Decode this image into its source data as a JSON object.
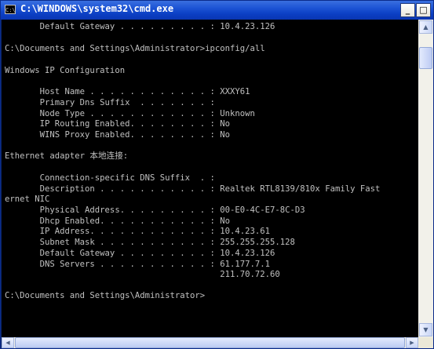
{
  "window": {
    "title": "C:\\WINDOWS\\system32\\cmd.exe",
    "icon_text": "C:\\",
    "minimize_glyph": "_",
    "maximize_glyph": "□",
    "close_glyph": "×"
  },
  "console": {
    "lines": [
      "       Default Gateway . . . . . . . . . : 10.4.23.126",
      "",
      "C:\\Documents and Settings\\Administrator>ipconfig/all",
      "",
      "Windows IP Configuration",
      "",
      "       Host Name . . . . . . . . . . . . : XXXY61",
      "       Primary Dns Suffix  . . . . . . . :",
      "       Node Type . . . . . . . . . . . . : Unknown",
      "       IP Routing Enabled. . . . . . . . : No",
      "       WINS Proxy Enabled. . . . . . . . : No",
      "",
      "Ethernet adapter 本地连接:",
      "",
      "       Connection-specific DNS Suffix  . :",
      "       Description . . . . . . . . . . . : Realtek RTL8139/810x Family Fast",
      "ernet NIC",
      "       Physical Address. . . . . . . . . : 00-E0-4C-E7-8C-D3",
      "       Dhcp Enabled. . . . . . . . . . . : No",
      "       IP Address. . . . . . . . . . . . : 10.4.23.61",
      "       Subnet Mask . . . . . . . . . . . : 255.255.255.128",
      "       Default Gateway . . . . . . . . . : 10.4.23.126",
      "       DNS Servers . . . . . . . . . . . : 61.177.7.1",
      "                                           211.70.72.60",
      "",
      "C:\\Documents and Settings\\Administrator>"
    ]
  },
  "scrollbars": {
    "up_glyph": "▲",
    "down_glyph": "▼",
    "left_glyph": "◀",
    "right_glyph": "▶"
  }
}
